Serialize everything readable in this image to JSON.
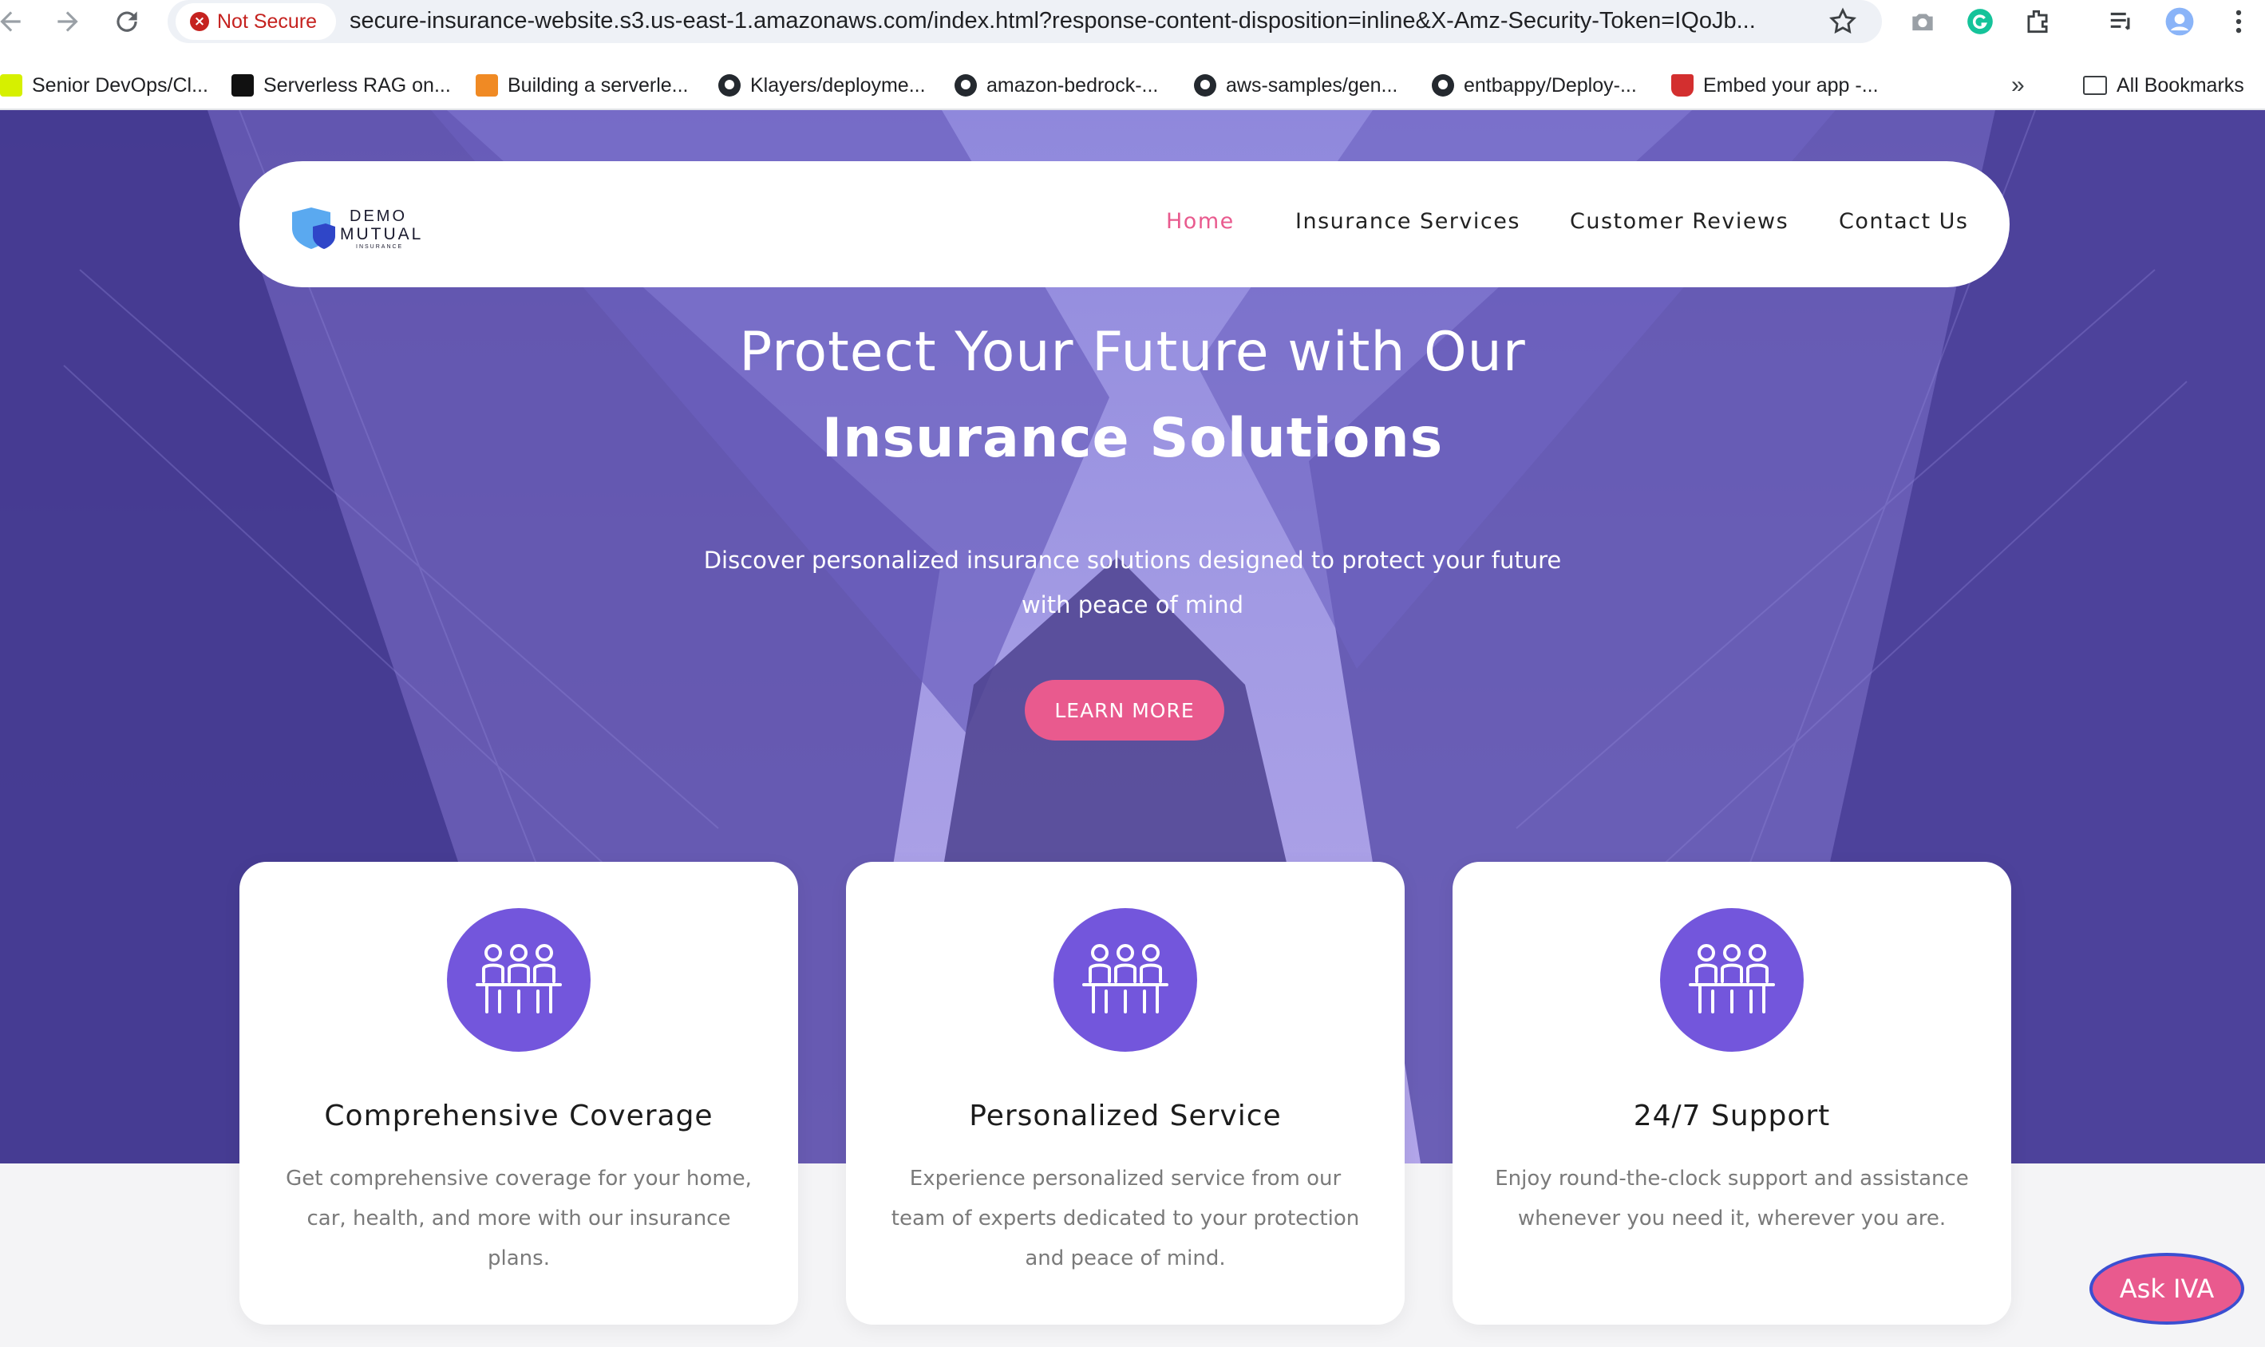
{
  "browser": {
    "security_label": "Not Secure",
    "url": "secure-insurance-website.s3.us-east-1.amazonaws.com/index.html?response-content-disposition=inline&X-Amz-Security-Token=IQoJb...",
    "bookmarks": [
      "Senior DevOps/Cl...",
      "Serverless RAG on...",
      "Building a serverle...",
      "Klayers/deployme...",
      "amazon-bedrock-...",
      "aws-samples/gen...",
      "entbappy/Deploy-...",
      "Embed your app -..."
    ],
    "overflow": "»",
    "all_bookmarks": "All Bookmarks"
  },
  "logo": {
    "line1": "DEMO",
    "line2": "MUTUAL",
    "line3": "INSURANCE"
  },
  "nav": {
    "items": [
      "Home",
      "Insurance Services",
      "Customer Reviews",
      "Contact Us"
    ],
    "active": "Home"
  },
  "hero": {
    "title_line1": "Protect Your Future with Our",
    "title_line2": "Insurance Solutions",
    "subtitle": "Discover personalized insurance solutions designed to protect your future with peace of mind",
    "cta": "LEARN MORE"
  },
  "features": [
    {
      "icon": "team-meeting-icon",
      "title": "Comprehensive Coverage",
      "text": "Get comprehensive coverage for your home, car, health, and more with our insurance plans."
    },
    {
      "icon": "team-meeting-icon",
      "title": "Personalized Service",
      "text": "Experience personalized service from our team of experts dedicated to your protection and peace of mind."
    },
    {
      "icon": "team-meeting-icon",
      "title": "24/7 Support",
      "text": "Enjoy round-the-clock support and assistance whenever you need it, wherever you are."
    }
  ],
  "chat_button": "Ask IVA",
  "colors": {
    "accent": "#e95a8e",
    "icon_bg": "#7356dc",
    "hero_tint": "#7d75cc"
  }
}
